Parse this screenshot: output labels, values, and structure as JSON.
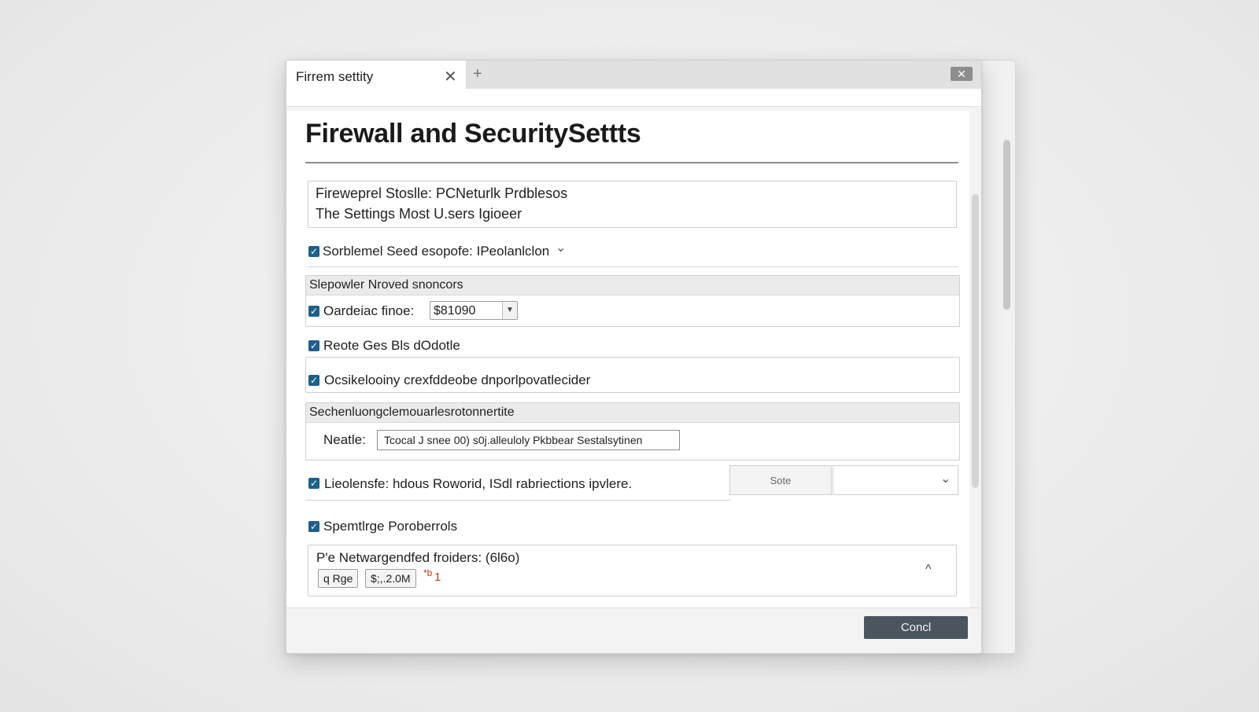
{
  "tab": {
    "title": "Firrem settity",
    "close_glyph": "✕",
    "add_glyph": "+"
  },
  "window": {
    "close_glyph": "✕"
  },
  "page": {
    "title": "Firewall and SecuritySettts"
  },
  "intro": {
    "line1": "Fireweprel Stoslle: PCNeturlk Prdblesos",
    "line2": "The Settings Most U.sers Igioeer"
  },
  "rows": {
    "row1": {
      "label": "Sorblemel Seed esopofe: IPeolanlclon",
      "chevron": "⌄"
    },
    "group1": {
      "header": "Slepowler Nroved snoncors",
      "check_label": "Oardeiac  finoe:",
      "select_value": "$81090",
      "select_arrow": "▼"
    },
    "row2": {
      "label": "Reote Ges Bls dOdotle"
    },
    "row3": {
      "label": "Ocsikelooiny crexfddeobe dnporlpovatlecider"
    },
    "group2": {
      "header": "Sechenluongclemouarlesrotonnertite",
      "field_label": "Neatle:",
      "field_value": "Tcocal J snee 00) s0j.alleuloly Pkbbear Sestalsytinen"
    },
    "row4": {
      "label": "Lieolensfe: hdous Roworid, ISdl rabriections ipvlere.",
      "button_label": "Sote",
      "chevron": "⌄"
    },
    "row5": {
      "label": "Spemtlrge Poroberrols"
    },
    "group3": {
      "title": "P'e Netwargendfed froiders: (6l6o)",
      "chip1": "q  Rge",
      "chip2": "$;,.2.0M",
      "badge_mark": "*b",
      "badge_count": "1",
      "collapse_glyph": "^"
    }
  },
  "footer": {
    "cancel_label": "Concl"
  },
  "colors": {
    "checkbox": "#1f5f8b",
    "button_dark": "#4b5560",
    "badge_red": "#c0392b"
  }
}
